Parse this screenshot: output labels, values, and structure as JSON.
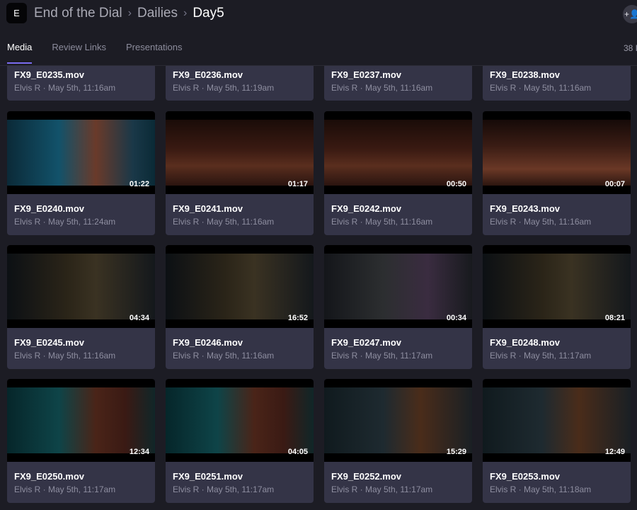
{
  "app": {
    "logo_letter": "E"
  },
  "breadcrumb": [
    "End of the Dial",
    "Dailies",
    "Day5"
  ],
  "tabs": [
    "Media",
    "Review Links",
    "Presentations"
  ],
  "item_count": "38 I",
  "invite_icon": "+👤",
  "top_row": [
    {
      "name": "FX9_E0235.mov",
      "meta": "Elvis R · May 5th, 11:16am"
    },
    {
      "name": "FX9_E0236.mov",
      "meta": "Elvis R · May 5th, 11:19am"
    },
    {
      "name": "FX9_E0237.mov",
      "meta": "Elvis R · May 5th, 11:16am"
    },
    {
      "name": "FX9_E0238.mov",
      "meta": "Elvis R · May 5th, 11:16am"
    }
  ],
  "rows": [
    [
      {
        "name": "FX9_E0240.mov",
        "meta": "Elvis R · May 5th, 11:24am",
        "duration": "01:22",
        "scene": "phone"
      },
      {
        "name": "FX9_E0241.mov",
        "meta": "Elvis R · May 5th, 11:16am",
        "duration": "01:17",
        "scene": "stage"
      },
      {
        "name": "FX9_E0242.mov",
        "meta": "Elvis R · May 5th, 11:16am",
        "duration": "00:50",
        "scene": "stage"
      },
      {
        "name": "FX9_E0243.mov",
        "meta": "Elvis R · May 5th, 11:16am",
        "duration": "00:07",
        "scene": "stage2"
      }
    ],
    [
      {
        "name": "FX9_E0245.mov",
        "meta": "Elvis R · May 5th, 11:16am",
        "duration": "04:34",
        "scene": "bar"
      },
      {
        "name": "FX9_E0246.mov",
        "meta": "Elvis R · May 5th, 11:16am",
        "duration": "16:52",
        "scene": "bar"
      },
      {
        "name": "FX9_E0247.mov",
        "meta": "Elvis R · May 5th, 11:17am",
        "duration": "00:34",
        "scene": "bar2"
      },
      {
        "name": "FX9_E0248.mov",
        "meta": "Elvis R · May 5th, 11:17am",
        "duration": "08:21",
        "scene": "bar"
      }
    ],
    [
      {
        "name": "FX9_E0250.mov",
        "meta": "Elvis R · May 5th, 11:17am",
        "duration": "12:34",
        "scene": "teal"
      },
      {
        "name": "FX9_E0251.mov",
        "meta": "Elvis R · May 5th, 11:17am",
        "duration": "04:05",
        "scene": "teal"
      },
      {
        "name": "FX9_E0252.mov",
        "meta": "Elvis R · May 5th, 11:17am",
        "duration": "15:29",
        "scene": "studio"
      },
      {
        "name": "FX9_E0253.mov",
        "meta": "Elvis R · May 5th, 11:18am",
        "duration": "12:49",
        "scene": "studio"
      }
    ]
  ]
}
